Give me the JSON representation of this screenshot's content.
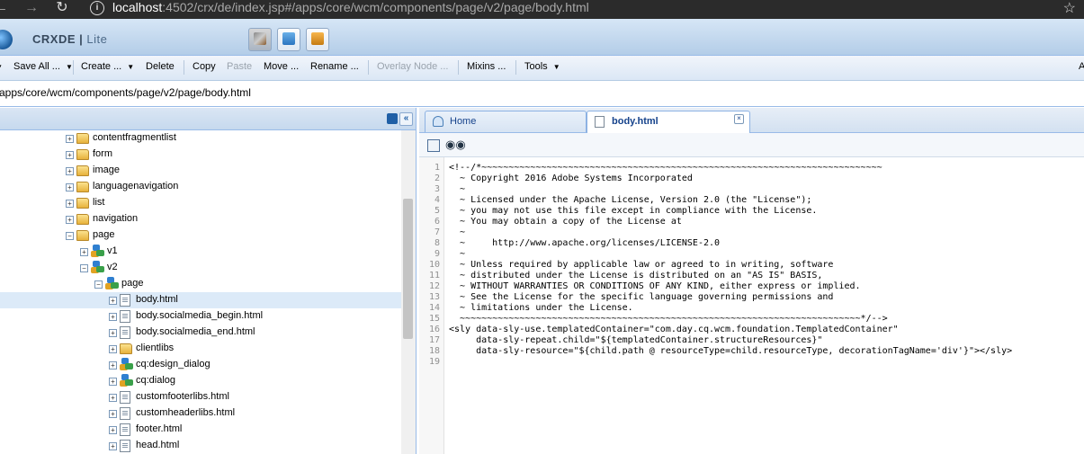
{
  "browser": {
    "url_host": "localhost",
    "url_rest": ":4502/crx/de/index.jsp#/apps/core/wcm/components/page/v2/page/body.html"
  },
  "app": {
    "logo": "CRXDE",
    "logo_suffix": "Lite"
  },
  "toolbar": {
    "save_all": "Save All ...",
    "create": "Create ...",
    "delete": "Delete",
    "copy": "Copy",
    "paste": "Paste",
    "move": "Move ...",
    "rename": "Rename ...",
    "overlay_node": "Overlay Node ...",
    "mixins": "Mixins ...",
    "tools": "Tools",
    "right_edge": "A"
  },
  "path": "apps/core/wcm/components/page/v2/page/body.html",
  "tree": [
    {
      "label": "contentfragmentlist",
      "type": "folder",
      "exp": "+"
    },
    {
      "label": "form",
      "type": "folder",
      "exp": "+"
    },
    {
      "label": "image",
      "type": "folder",
      "exp": "+"
    },
    {
      "label": "languagenavigation",
      "type": "folder",
      "exp": "+"
    },
    {
      "label": "list",
      "type": "folder",
      "exp": "+"
    },
    {
      "label": "navigation",
      "type": "folder",
      "exp": "+"
    },
    {
      "label": "page",
      "type": "folder",
      "exp": "−"
    },
    {
      "label": "v1",
      "type": "comp",
      "exp": "+"
    },
    {
      "label": "v2",
      "type": "comp",
      "exp": "−"
    },
    {
      "label": "page",
      "type": "comp",
      "exp": "−"
    },
    {
      "label": "body.html",
      "type": "file",
      "exp": "+",
      "selected": true
    },
    {
      "label": "body.socialmedia_begin.html",
      "type": "file",
      "exp": "+"
    },
    {
      "label": "body.socialmedia_end.html",
      "type": "file",
      "exp": "+"
    },
    {
      "label": "clientlibs",
      "type": "folder",
      "exp": "+"
    },
    {
      "label": "cq:design_dialog",
      "type": "comp",
      "exp": "+"
    },
    {
      "label": "cq:dialog",
      "type": "comp",
      "exp": "+"
    },
    {
      "label": "customfooterlibs.html",
      "type": "file",
      "exp": "+"
    },
    {
      "label": "customheaderlibs.html",
      "type": "file",
      "exp": "+"
    },
    {
      "label": "footer.html",
      "type": "file",
      "exp": "+"
    },
    {
      "label": "head.html",
      "type": "file",
      "exp": "+"
    }
  ],
  "tabs": {
    "home": "Home",
    "file": "body.html"
  },
  "code": [
    "<!--/*~~~~~~~~~~~~~~~~~~~~~~~~~~~~~~~~~~~~~~~~~~~~~~~~~~~~~~~~~~~~~~~~~~~~~~~~~~",
    "  ~ Copyright 2016 Adobe Systems Incorporated",
    "  ~",
    "  ~ Licensed under the Apache License, Version 2.0 (the \"License\");",
    "  ~ you may not use this file except in compliance with the License.",
    "  ~ You may obtain a copy of the License at",
    "  ~",
    "  ~     http://www.apache.org/licenses/LICENSE-2.0",
    "  ~",
    "  ~ Unless required by applicable law or agreed to in writing, software",
    "  ~ distributed under the License is distributed on an \"AS IS\" BASIS,",
    "  ~ WITHOUT WARRANTIES OR CONDITIONS OF ANY KIND, either express or implied.",
    "  ~ See the License for the specific language governing permissions and",
    "  ~ limitations under the License.",
    "  ~~~~~~~~~~~~~~~~~~~~~~~~~~~~~~~~~~~~~~~~~~~~~~~~~~~~~~~~~~~~~~~~~~~~~~~~~~*/-->",
    "<sly data-sly-use.templatedContainer=\"com.day.cq.wcm.foundation.TemplatedContainer\"",
    "     data-sly-repeat.child=\"${templatedContainer.structureResources}\"",
    "     data-sly-resource=\"${child.path @ resourceType=child.resourceType, decorationTagName='div'}\"></sly>",
    ""
  ]
}
